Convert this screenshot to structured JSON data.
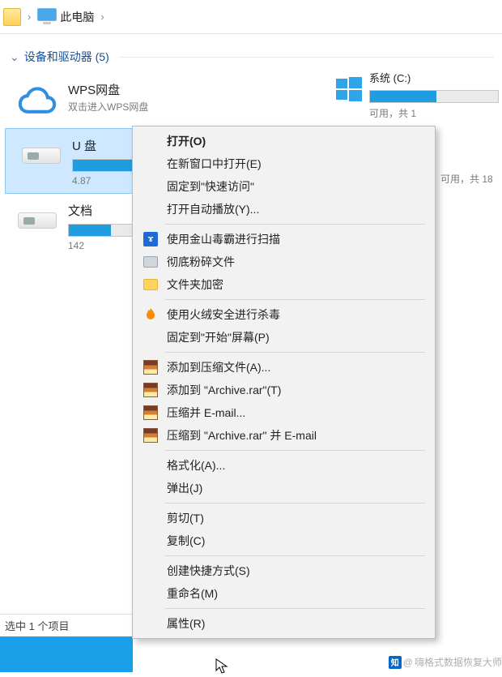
{
  "breadcrumb": {
    "location": "此电脑"
  },
  "section": {
    "title_prefix": "设备和驱动器",
    "count": "(5)"
  },
  "drives": {
    "wps": {
      "title": "WPS网盘",
      "subtitle": "双击进入WPS网盘"
    },
    "udisk": {
      "title": "U 盘",
      "free_text": "4.87"
    },
    "docs": {
      "title": "文档",
      "free_text": "142"
    },
    "system": {
      "title": "系统 (C:)",
      "free_text": "可用，共 1"
    },
    "right2_free_text": "可用，共 18"
  },
  "context_menu": {
    "open": "打开(O)",
    "open_new_window": "在新窗口中打开(E)",
    "pin_quick_access": "固定到\"快速访问\"",
    "open_autoplay": "打开自动播放(Y)...",
    "kingsoft_scan": "使用金山毒霸进行扫描",
    "shred": "彻底粉碎文件",
    "folder_encrypt": "文件夹加密",
    "huorong_scan": "使用火绒安全进行杀毒",
    "pin_start": "固定到\"开始\"屏幕(P)",
    "rar_add": "添加到压缩文件(A)...",
    "rar_add_named": "添加到 \"Archive.rar\"(T)",
    "rar_email": "压缩并 E-mail...",
    "rar_email_named": "压缩到 \"Archive.rar\" 并 E-mail",
    "format": "格式化(A)...",
    "eject": "弹出(J)",
    "cut": "剪切(T)",
    "copy": "复制(C)",
    "create_shortcut": "创建快捷方式(S)",
    "rename": "重命名(M)",
    "properties": "属性(R)"
  },
  "status_bar": "选中 1 个项目",
  "watermark": {
    "prefix": "@",
    "name": "嗨格式数据恢复大师"
  }
}
